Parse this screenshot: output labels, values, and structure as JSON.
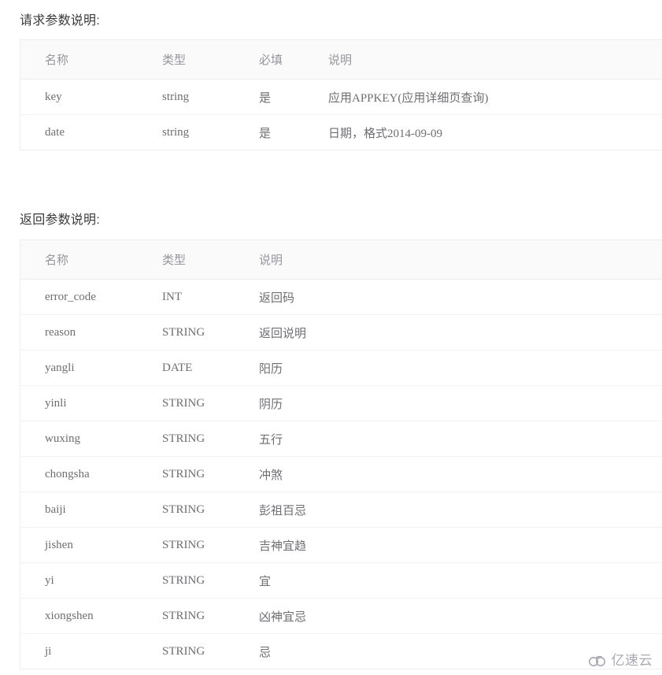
{
  "sections": [
    {
      "title": "请求参数说明:",
      "table": {
        "columns": [
          "名称",
          "类型",
          "必填",
          "说明"
        ],
        "rows": [
          [
            "key",
            "string",
            "是",
            "应用APPKEY(应用详细页查询)"
          ],
          [
            "date",
            "string",
            "是",
            "日期，格式2014-09-09"
          ]
        ]
      }
    },
    {
      "title": "返回参数说明:",
      "table": {
        "columns": [
          "名称",
          "类型",
          "说明"
        ],
        "rows": [
          [
            "error_code",
            "INT",
            "返回码"
          ],
          [
            "reason",
            "STRING",
            "返回说明"
          ],
          [
            "yangli",
            "DATE",
            "阳历"
          ],
          [
            "yinli",
            "STRING",
            "阴历"
          ],
          [
            "wuxing",
            "STRING",
            "五行"
          ],
          [
            "chongsha",
            "STRING",
            "冲煞"
          ],
          [
            "baiji",
            "STRING",
            "彭祖百忌"
          ],
          [
            "jishen",
            "STRING",
            "吉神宜趋"
          ],
          [
            "yi",
            "STRING",
            "宜"
          ],
          [
            "xiongshen",
            "STRING",
            "凶神宜忌"
          ],
          [
            "ji",
            "STRING",
            "忌"
          ]
        ]
      }
    }
  ],
  "watermark": {
    "text": "亿速云",
    "icon": "cloud-icon",
    "color": "#9a9aa6"
  },
  "colors": {
    "page_background": "#ffffff",
    "header_background": "#fafafb",
    "border": "#ededf0",
    "row_separator": "#f2f2f4",
    "title_text": "#3a3a3a",
    "header_text": "#96969c",
    "cell_text": "#6e6e73"
  }
}
